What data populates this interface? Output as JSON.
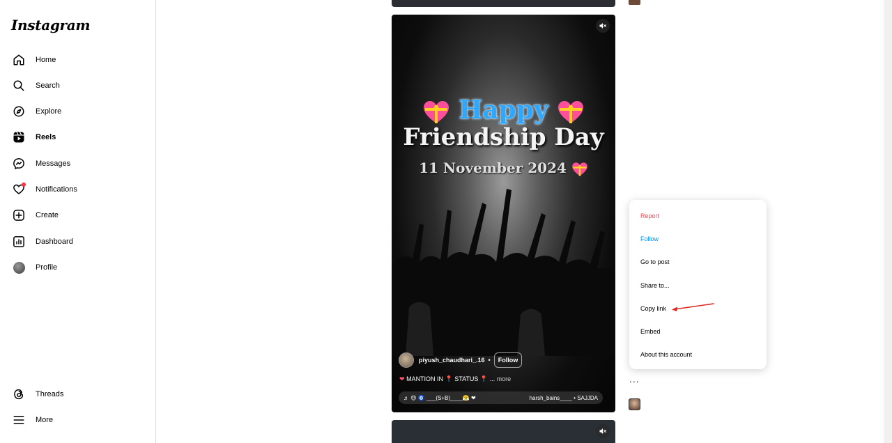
{
  "sidebar": {
    "logo": "Instagram",
    "items": [
      {
        "label": "Home"
      },
      {
        "label": "Search"
      },
      {
        "label": "Explore"
      },
      {
        "label": "Reels"
      },
      {
        "label": "Messages"
      },
      {
        "label": "Notifications"
      },
      {
        "label": "Create"
      },
      {
        "label": "Dashboard"
      },
      {
        "label": "Profile"
      }
    ],
    "bottom": [
      {
        "label": "Threads"
      },
      {
        "label": "More"
      }
    ]
  },
  "reel": {
    "overlay": {
      "line1": "Happy",
      "line2": "Friendship Day",
      "line3": "11 November 2024"
    },
    "owner": "piyush_chaudhari_.16",
    "follow_label": "Follow",
    "caption": "MANTION IN 📍 STATUS 📍 ...",
    "caption_more": "more",
    "audio_left": "♬ 😍 🧿 ___(S+B)____😤 ❤",
    "audio_right": "harsh_bains____ • SAJJDA"
  },
  "menu": {
    "items": [
      {
        "label": "Report"
      },
      {
        "label": "Follow"
      },
      {
        "label": "Go to post"
      },
      {
        "label": "Share to..."
      },
      {
        "label": "Copy link"
      },
      {
        "label": "Embed"
      },
      {
        "label": "About this account"
      }
    ]
  },
  "side": {
    "more_label": "..."
  },
  "colors": {
    "danger": "#ed4956",
    "primary": "#0095f6",
    "notification_dot": "#ff3040",
    "annotation_arrow": "#e0231b"
  }
}
